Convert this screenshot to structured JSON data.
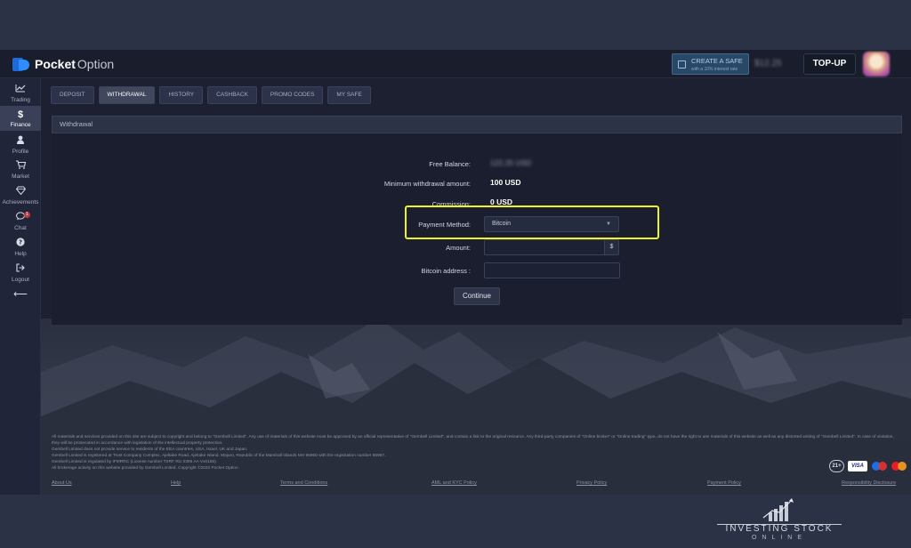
{
  "header": {
    "logo_bold": "Pocket",
    "logo_light": "Option",
    "safe_line1": "CREATE A SAFE",
    "safe_line2": "with a 10% interest rate",
    "balance": "$12.25",
    "topup_label": "TOP-UP"
  },
  "sidebar": {
    "items": [
      {
        "label": "Trading",
        "icon": "chart-line-icon"
      },
      {
        "label": "Finance",
        "icon": "dollar-icon"
      },
      {
        "label": "Profile",
        "icon": "user-icon"
      },
      {
        "label": "Market",
        "icon": "cart-icon"
      },
      {
        "label": "Achievements",
        "icon": "diamond-icon"
      },
      {
        "label": "Chat",
        "icon": "chat-icon",
        "badge": "1"
      },
      {
        "label": "Help",
        "icon": "question-icon"
      },
      {
        "label": "Logout",
        "icon": "logout-icon"
      }
    ]
  },
  "tabs": [
    "DEPOSIT",
    "WITHDRAWAL",
    "HISTORY",
    "CASHBACK",
    "PROMO CODES",
    "MY SAFE"
  ],
  "panel": {
    "title": "Withdrawal",
    "free_balance_label": "Free Balance:",
    "free_balance_value": "122.25 USD",
    "min_label": "Minimum withdrawal amount:",
    "min_value": "100 USD",
    "commission_label": "Commission:",
    "commission_value": "0 USD",
    "payment_label": "Payment Method:",
    "payment_value": "Bitcoin",
    "amount_label": "Amount:",
    "amount_suffix": "$",
    "btc_label": "Bitcoin address :",
    "continue_label": "Continue"
  },
  "footer": {
    "fine_1": "All materials and services provided on this site are subject to copyright and belong to \"Gembell Limited\". Any use of materials of this website must be approved by an official representative of \"Gembell Limited\", and contain a link to the original resource. Any third-party companies of \"Online broker\" or \"Online trading\" type, do not have the right to use materials of this website as well as any distorted writing of \"Gembell Limited\". In case of violation, they will be prosecuted in accordance with legislation of the intellectual property protection.",
    "fine_2": "Gembell Limited does not provide service to residents of the EEA countries, USA, Israel, UK and Japan.",
    "fine_3": "Gembell Limited is registered at Trust Company Complex, Ajeltake Road, Ajeltake Island, Majuro, Republic of the Marshall Islands MH 96960 with the registration number 86967.",
    "fine_4": "Gembell Limited is regulated by IFMRRC (License number TSRF RU 0395 AA Vv0158).",
    "fine_5": "All brokerage activity on this website provided by Gembell Limited. Copyright ©2022 Pocket Option",
    "links": [
      "About Us",
      "Help",
      "Terms and Conditions",
      "AML and KYC Policy",
      "Privacy Policy",
      "Payment Policy",
      "Responsibility Disclosure"
    ],
    "age_badge": "21+",
    "visa": "VISA"
  },
  "watermark": {
    "line1": "INVESTING STOCK",
    "line2": "ONLINE"
  }
}
